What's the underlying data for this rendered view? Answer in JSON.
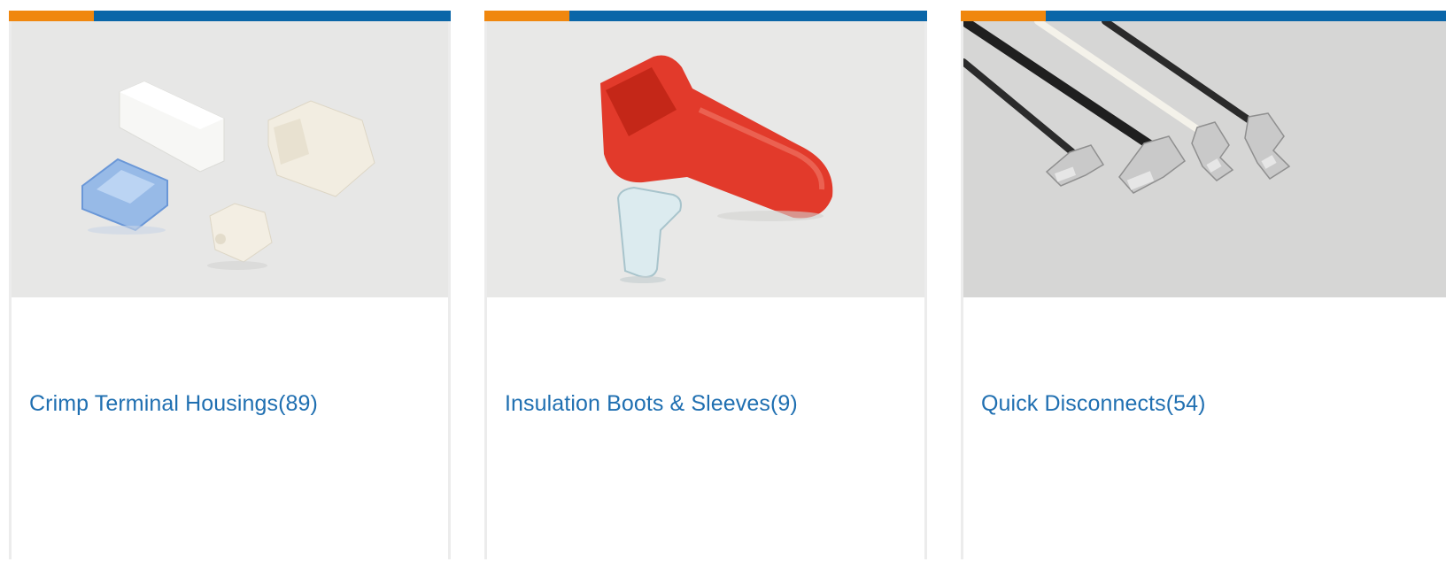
{
  "theme": {
    "accent_color": "#f0870e",
    "bar_color": "#0a66a8",
    "link_color": "#1f6fb1"
  },
  "cards": [
    {
      "title": "Crimp Terminal Housings",
      "count": "(89)",
      "image_icon": "crimp-terminal-housings-image"
    },
    {
      "title": "Insulation Boots & Sleeves",
      "count": "(9)",
      "image_icon": "insulation-boot-image"
    },
    {
      "title": "Quick Disconnects",
      "count": "(54)",
      "image_icon": "quick-disconnect-image"
    }
  ]
}
